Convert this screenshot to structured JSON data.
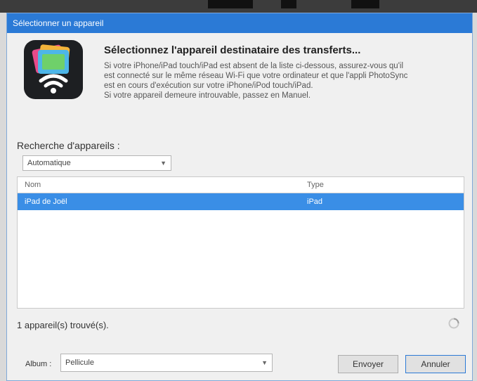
{
  "window": {
    "title": "Sélectionner un appareil"
  },
  "header": {
    "heading": "Sélectionnez l'appareil destinataire des transferts...",
    "lines": [
      "Si votre iPhone/iPad touch/iPad est absent de la liste ci-dessous, assurez-vous qu'il",
      "est connecté sur le même réseau Wi-Fi que votre ordinateur et que l'appli PhotoSync",
      "est en cours d'exécution sur votre iPhone/iPod touch/iPad.",
      "Si votre appareil demeure introuvable, passez en Manuel."
    ]
  },
  "search": {
    "label": "Recherche d'appareils :",
    "mode": "Automatique"
  },
  "devices": {
    "columns": {
      "name": "Nom",
      "type": "Type"
    },
    "rows": [
      {
        "name": "iPad de Joël",
        "type": "iPad",
        "selected": true
      }
    ],
    "found_text": "1 appareil(s) trouvé(s)."
  },
  "footer": {
    "album_label": "Album :",
    "album_value": "Pellicule",
    "send_label": "Envoyer",
    "cancel_label": "Annuler"
  },
  "colors": {
    "accent": "#2b7ad6",
    "selection": "#3a8ee6"
  }
}
